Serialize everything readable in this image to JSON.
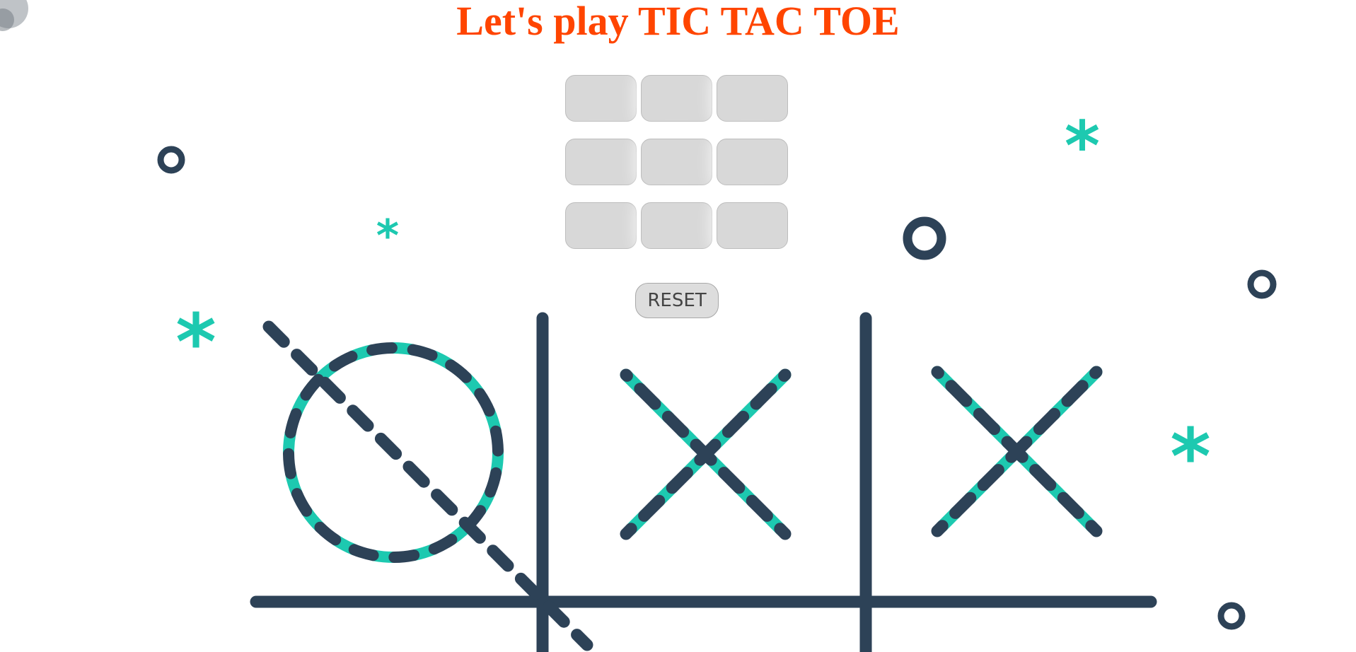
{
  "title": "Let's play TIC TAC TOE",
  "board": {
    "cells": [
      "",
      "",
      "",
      "",
      "",
      "",
      "",
      "",
      ""
    ]
  },
  "reset_label": "RESET",
  "colors": {
    "title": "#ff4500",
    "background_dark": "#2d4257",
    "background_accent": "#1dc9b0",
    "cell_fill": "#d8d8d8"
  },
  "background": {
    "description_icons": [
      "tic-tac-toe-grid-illustration",
      "circle-icon",
      "asterisk-icon"
    ]
  }
}
